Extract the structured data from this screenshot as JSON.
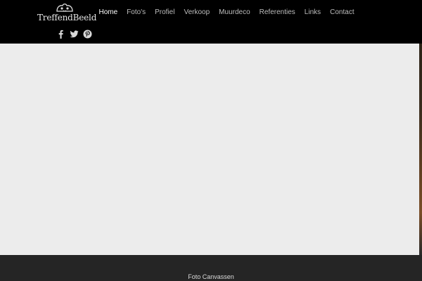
{
  "brand": {
    "logo_text": "TreffendBeeld"
  },
  "nav": {
    "items": [
      {
        "label": "Home",
        "active": true
      },
      {
        "label": "Foto's",
        "active": false
      },
      {
        "label": "Profiel",
        "active": false
      },
      {
        "label": "Verkoop",
        "active": false
      },
      {
        "label": "Muurdeco",
        "active": false
      },
      {
        "label": "Referenties",
        "active": false
      },
      {
        "label": "Links",
        "active": false
      },
      {
        "label": "Contact",
        "active": false
      }
    ]
  },
  "social": {
    "icons": [
      "facebook-icon",
      "twitter-icon",
      "pinterest-icon"
    ]
  },
  "footer": {
    "text": "Foto Canvassen"
  },
  "colors": {
    "header_bg": "#000000",
    "content_bg": "#ececec",
    "footer_bg": "#252525",
    "nav_active": "#ffffff",
    "nav_inactive": "#bdbdbd"
  }
}
